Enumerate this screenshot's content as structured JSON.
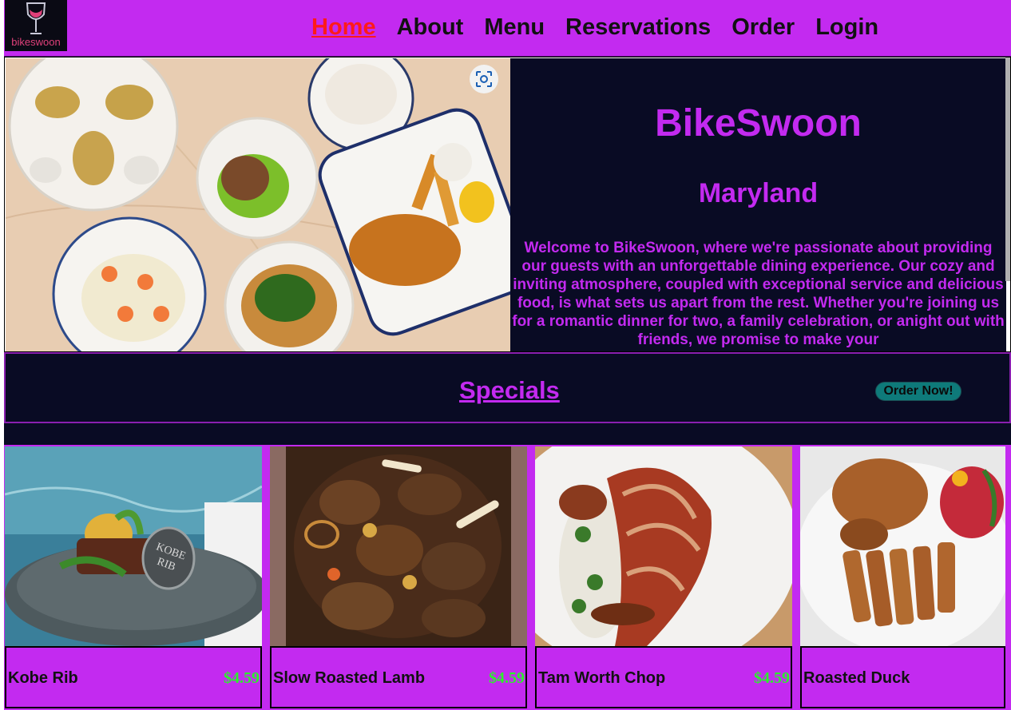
{
  "header": {
    "logo_text": "bikeswoon",
    "nav": [
      {
        "label": "Home",
        "active": true
      },
      {
        "label": "About",
        "active": false
      },
      {
        "label": "Menu",
        "active": false
      },
      {
        "label": "Reservations",
        "active": false
      },
      {
        "label": "Order",
        "active": false
      },
      {
        "label": "Login",
        "active": false
      }
    ]
  },
  "hero": {
    "title": "BikeSwoon",
    "subtitle": "Maryland",
    "description": "Welcome to BikeSwoon, where we're passionate about providing our guests with an unforgettable dining experience. Our cozy and inviting atmosphere, coupled with exceptional service and delicious food, is what sets us apart from the rest. Whether you're joining us for a romantic dinner for two, a family celebration, or anight out with friends, we promise to make your",
    "image_icon": "visual-search-icon"
  },
  "specials": {
    "title": "Specials",
    "order_button": "Order Now!"
  },
  "cards": [
    {
      "name": "Kobe Rib",
      "price": "$4.59"
    },
    {
      "name": "Slow Roasted Lamb",
      "price": "$4.59"
    },
    {
      "name": "Tam Worth Chop",
      "price": "$4.59"
    },
    {
      "name": "Roasted Duck",
      "price": ""
    }
  ],
  "colors": {
    "brand_purple": "#c32af0",
    "dark_navy": "#090b24",
    "price_green": "#2cf02c",
    "active_nav": "#ff1a1a",
    "order_button": "#0e7a7a"
  }
}
